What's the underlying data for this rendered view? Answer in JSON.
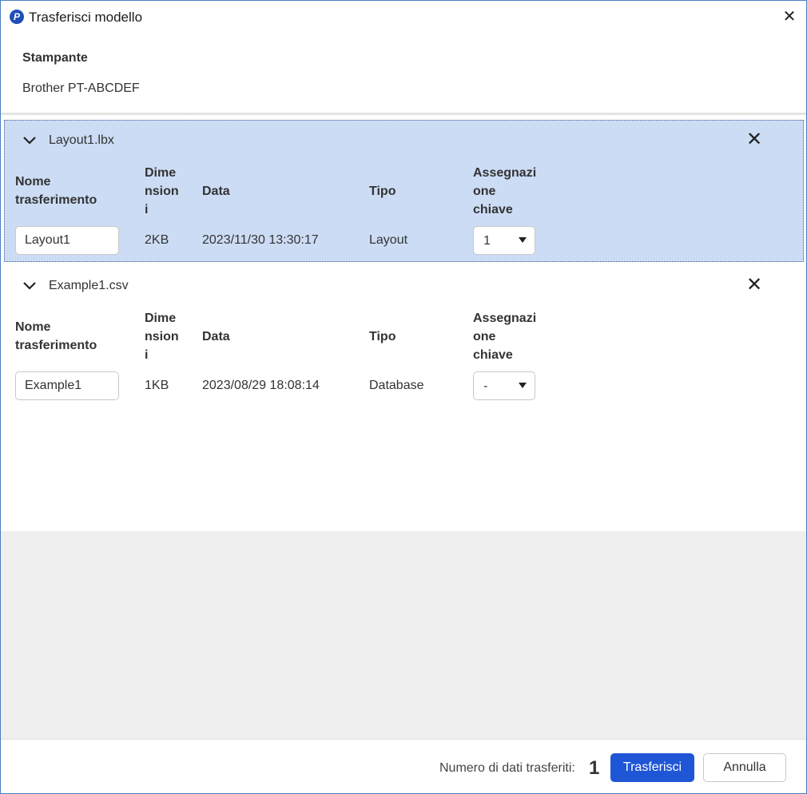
{
  "window": {
    "title": "Trasferisci modello",
    "app_icon_glyph": "P",
    "close_glyph": "✕"
  },
  "printer": {
    "label": "Stampante",
    "name": "Brother PT-ABCDEF"
  },
  "columns": {
    "name": "Nome trasferimento",
    "size": "Dime nsion i",
    "date": "Data",
    "type": "Tipo",
    "key": "Assegnazi one chiave"
  },
  "files": [
    {
      "filename": "Layout1.lbx",
      "transfer_name": "Layout1",
      "size": "2KB",
      "date": "2023/11/30 13:30:17",
      "type": "Layout",
      "key": "1",
      "selected": true
    },
    {
      "filename": "Example1.csv",
      "transfer_name": "Example1",
      "size": "1KB",
      "date": "2023/08/29 18:08:14",
      "type": "Database",
      "key": "-",
      "selected": false
    }
  ],
  "remove_glyph": "✕",
  "footer": {
    "count_label": "Numero di dati trasferiti:",
    "count_value": "1",
    "transfer_button": "Trasferisci",
    "cancel_button": "Annulla"
  },
  "colors": {
    "accent": "#1f56d6",
    "selected_row": "#ccdcf5",
    "window_border": "#4a7fc1",
    "gray_area": "#efefef"
  },
  "icons": {
    "expand": "chevron-down-icon",
    "remove": "close-icon",
    "dropdown": "caret-down-icon",
    "app": "brother-p-touch-icon"
  }
}
